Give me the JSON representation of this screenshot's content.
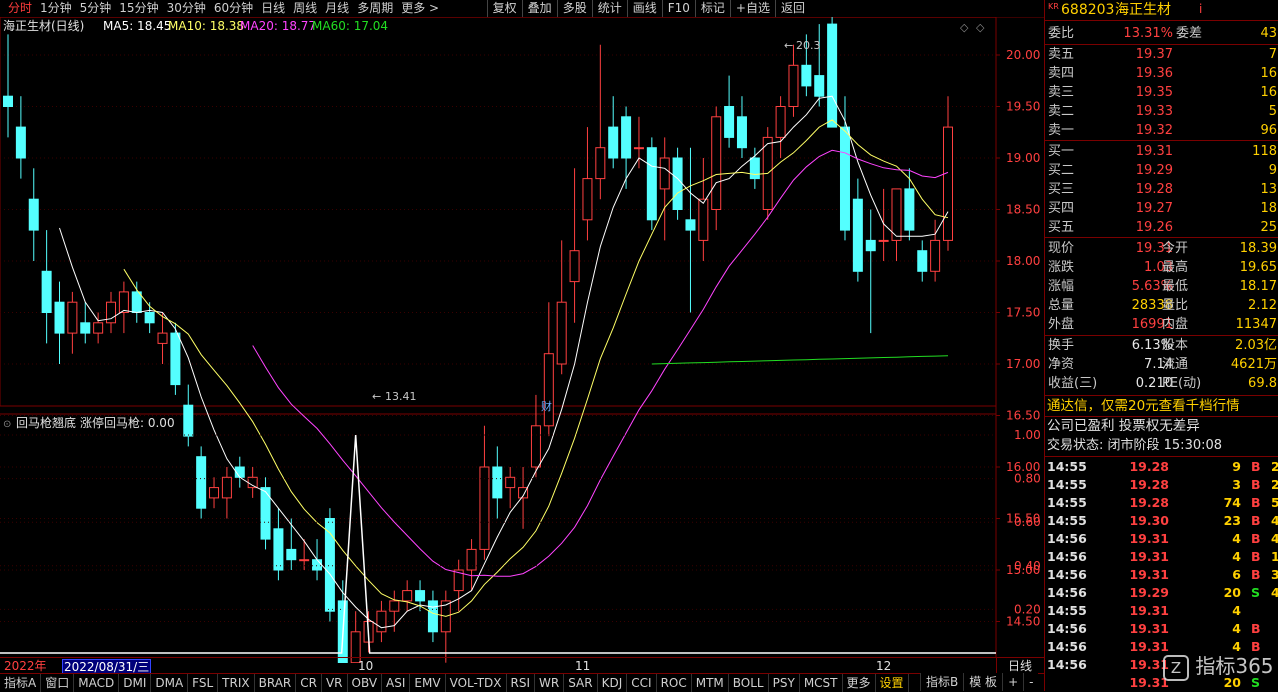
{
  "toolbar": {
    "periods": [
      "分时",
      "1分钟",
      "5分钟",
      "15分钟",
      "30分钟",
      "60分钟",
      "日线",
      "周线",
      "月线",
      "多周期",
      "更多 >"
    ],
    "active_period": "分时",
    "tools": [
      "复权",
      "叠加",
      "多股",
      "统计",
      "画线",
      "F10",
      "标记",
      "+自选",
      "返回"
    ]
  },
  "chart_header": {
    "stock": "海正生材(日线)",
    "ma5": "MA5: 18.45",
    "ma10": "MA10: 18.38",
    "ma20": "MA20: 18.77",
    "ma60": "MA60: 17.04",
    "high_label": "20.3",
    "low_label": "13.41",
    "marker": "财"
  },
  "indicator_header": {
    "name": "回马枪翘底",
    "value": "涨停回马枪: 0.00"
  },
  "chart_data": [
    {
      "type": "candlestick",
      "title": "海正生材(日线)",
      "y_ticks": [
        "20.00",
        "19.50",
        "19.00",
        "18.50",
        "18.00",
        "17.50",
        "17.00",
        "16.50",
        "16.00",
        "15.50",
        "15.00",
        "14.50",
        "14.00"
      ],
      "series": [
        {
          "name": "MA5",
          "color": "#ffffff"
        },
        {
          "name": "MA10",
          "color": "#ffff66"
        },
        {
          "name": "MA20",
          "color": "#ff44ff"
        },
        {
          "name": "MA60",
          "color": "#22dd22"
        }
      ],
      "ohlc": [
        [
          19.6,
          20.2,
          19.2,
          19.5
        ],
        [
          19.3,
          19.6,
          18.8,
          19.0
        ],
        [
          18.6,
          18.9,
          18.0,
          18.3
        ],
        [
          17.9,
          18.3,
          17.2,
          17.5
        ],
        [
          17.6,
          17.8,
          17.0,
          17.3
        ],
        [
          17.3,
          17.7,
          17.1,
          17.6
        ],
        [
          17.4,
          17.6,
          17.2,
          17.3
        ],
        [
          17.3,
          17.5,
          17.2,
          17.4
        ],
        [
          17.4,
          17.7,
          17.3,
          17.6
        ],
        [
          17.5,
          17.8,
          17.3,
          17.7
        ],
        [
          17.7,
          17.8,
          17.4,
          17.5
        ],
        [
          17.5,
          17.6,
          17.3,
          17.4
        ],
        [
          17.2,
          17.5,
          17.0,
          17.3
        ],
        [
          17.3,
          17.4,
          16.7,
          16.8
        ],
        [
          16.6,
          16.8,
          16.2,
          16.3
        ],
        [
          16.1,
          16.2,
          15.5,
          15.6
        ],
        [
          15.7,
          15.9,
          15.6,
          15.8
        ],
        [
          15.7,
          16.0,
          15.5,
          15.9
        ],
        [
          16.0,
          16.1,
          15.8,
          15.9
        ],
        [
          15.8,
          16.0,
          15.7,
          15.9
        ],
        [
          15.8,
          15.9,
          15.2,
          15.3
        ],
        [
          15.4,
          15.6,
          14.9,
          15.0
        ],
        [
          15.2,
          15.5,
          15.0,
          15.1
        ],
        [
          15.1,
          15.3,
          15.0,
          15.1
        ],
        [
          15.1,
          15.3,
          14.9,
          15.0
        ],
        [
          15.5,
          15.6,
          14.5,
          14.6
        ],
        [
          14.7,
          14.9,
          13.9,
          14.1
        ],
        [
          14.1,
          14.6,
          13.6,
          14.4
        ],
        [
          14.3,
          14.6,
          14.2,
          14.5
        ],
        [
          14.4,
          14.7,
          14.3,
          14.6
        ],
        [
          14.6,
          14.8,
          14.4,
          14.7
        ],
        [
          14.7,
          14.9,
          14.6,
          14.8
        ],
        [
          14.8,
          14.9,
          14.6,
          14.7
        ],
        [
          14.7,
          14.8,
          14.3,
          14.4
        ],
        [
          14.4,
          14.8,
          14.1,
          14.7
        ],
        [
          14.8,
          15.1,
          14.6,
          15.0
        ],
        [
          15.0,
          15.3,
          14.8,
          15.2
        ],
        [
          15.2,
          16.4,
          15.1,
          16.0
        ],
        [
          16.0,
          16.2,
          15.5,
          15.7
        ],
        [
          15.8,
          16.0,
          15.6,
          15.9
        ],
        [
          15.7,
          16.0,
          15.4,
          15.8
        ],
        [
          16.0,
          16.7,
          15.9,
          16.4
        ],
        [
          16.4,
          17.6,
          16.3,
          17.1
        ],
        [
          17.0,
          18.2,
          16.9,
          17.6
        ],
        [
          17.8,
          18.9,
          17.4,
          18.1
        ],
        [
          18.4,
          19.3,
          18.2,
          18.8
        ],
        [
          18.8,
          20.1,
          18.6,
          19.1
        ],
        [
          19.3,
          19.6,
          18.9,
          19.0
        ],
        [
          19.4,
          19.5,
          18.7,
          19.0
        ],
        [
          19.1,
          19.4,
          18.9,
          19.1
        ],
        [
          19.1,
          19.2,
          18.3,
          18.4
        ],
        [
          18.7,
          19.2,
          18.2,
          19.0
        ],
        [
          19.0,
          19.1,
          18.4,
          18.5
        ],
        [
          18.4,
          19.1,
          17.5,
          18.3
        ],
        [
          18.2,
          19.0,
          18.0,
          18.6
        ],
        [
          18.5,
          19.5,
          18.3,
          19.4
        ],
        [
          19.5,
          19.8,
          19.1,
          19.2
        ],
        [
          19.4,
          19.6,
          19.0,
          19.1
        ],
        [
          19.0,
          19.1,
          18.7,
          18.8
        ],
        [
          18.5,
          19.3,
          18.4,
          19.2
        ],
        [
          19.2,
          19.6,
          19.0,
          19.5
        ],
        [
          19.5,
          20.1,
          19.4,
          19.9
        ],
        [
          19.9,
          20.2,
          19.6,
          19.7
        ],
        [
          19.8,
          20.3,
          19.5,
          19.6
        ],
        [
          20.3,
          20.4,
          19.3,
          19.3
        ],
        [
          19.3,
          19.6,
          18.2,
          18.3
        ],
        [
          18.6,
          18.8,
          17.8,
          17.9
        ],
        [
          18.2,
          18.5,
          17.3,
          18.1
        ],
        [
          18.2,
          18.7,
          18.0,
          18.2
        ],
        [
          18.2,
          18.7,
          18.0,
          18.7
        ],
        [
          18.7,
          18.9,
          18.2,
          18.3
        ],
        [
          18.1,
          18.2,
          17.8,
          17.9
        ],
        [
          17.9,
          18.4,
          17.8,
          18.2
        ],
        [
          18.2,
          19.6,
          18.1,
          19.3
        ]
      ]
    },
    {
      "type": "line",
      "title": "回马枪翘底",
      "y_ticks": [
        "1.00",
        "0.80",
        "0.60",
        "0.40",
        "0.20"
      ],
      "x_labels": [
        "2022年",
        "2022/08/31/三",
        "10",
        "11",
        "12"
      ],
      "spike": {
        "name": "涨停回马枪",
        "peak_value": 1.0
      }
    }
  ],
  "panel": {
    "code": "688203",
    "name": "海正生材",
    "weibi": {
      "label": "委比",
      "value": "13.31%",
      "label2": "委差",
      "value2": "43"
    },
    "asks": [
      {
        "label": "卖五",
        "price": "19.37",
        "vol": "7"
      },
      {
        "label": "卖四",
        "price": "19.36",
        "vol": "16"
      },
      {
        "label": "卖三",
        "price": "19.35",
        "vol": "16"
      },
      {
        "label": "卖二",
        "price": "19.33",
        "vol": "5"
      },
      {
        "label": "卖一",
        "price": "19.32",
        "vol": "96"
      }
    ],
    "bids": [
      {
        "label": "买一",
        "price": "19.31",
        "vol": "118"
      },
      {
        "label": "买二",
        "price": "19.29",
        "vol": "9"
      },
      {
        "label": "买三",
        "price": "19.28",
        "vol": "13"
      },
      {
        "label": "买四",
        "price": "19.27",
        "vol": "18"
      },
      {
        "label": "买五",
        "price": "19.26",
        "vol": "25"
      }
    ],
    "stats": [
      {
        "l1": "现价",
        "v1": "19.31",
        "l2": "今开",
        "v2": "18.39"
      },
      {
        "l1": "涨跌",
        "v1": "1.03",
        "l2": "最高",
        "v2": "19.65"
      },
      {
        "l1": "涨幅",
        "v1": "5.63%",
        "l2": "最低",
        "v2": "18.17"
      },
      {
        "l1": "总量",
        "v1": "28338",
        "l2": "量比",
        "v2": "2.12"
      },
      {
        "l1": "外盘",
        "v1": "16991",
        "l2": "内盘",
        "v2": "11347"
      }
    ],
    "stats2": [
      {
        "l1": "换手",
        "v1": "6.13%",
        "l2": "股本",
        "v2": "2.03亿"
      },
      {
        "l1": "净资",
        "v1": "7.14",
        "l2": "流通",
        "v2": "4621万"
      },
      {
        "l1": "收益(三)",
        "v1": "0.210",
        "l2": "PE(动)",
        "v2": "69.8"
      }
    ],
    "ad": "通达信，仅需20元查看千档行情",
    "info": "公司已盈利 投票权无差异",
    "trade_status": "交易状态: 闭市阶段 15:30:08",
    "ticks": [
      {
        "t": "14:55",
        "p": "19.28",
        "v": "9",
        "d": "B",
        "n": "2"
      },
      {
        "t": "14:55",
        "p": "19.28",
        "v": "3",
        "d": "B",
        "n": "2"
      },
      {
        "t": "14:55",
        "p": "19.28",
        "v": "74",
        "d": "B",
        "n": "5"
      },
      {
        "t": "14:55",
        "p": "19.30",
        "v": "23",
        "d": "B",
        "n": "4"
      },
      {
        "t": "14:56",
        "p": "19.31",
        "v": "4",
        "d": "B",
        "n": "4"
      },
      {
        "t": "14:56",
        "p": "19.31",
        "v": "4",
        "d": "B",
        "n": "1"
      },
      {
        "t": "14:56",
        "p": "19.31",
        "v": "6",
        "d": "B",
        "n": "3"
      },
      {
        "t": "14:56",
        "p": "19.29",
        "v": "20",
        "d": "S",
        "n": "4"
      },
      {
        "t": "14:55",
        "p": "19.31",
        "v": "4",
        "d": "",
        "n": ""
      },
      {
        "t": "14:56",
        "p": "19.31",
        "v": "4",
        "d": "B",
        "n": ""
      },
      {
        "t": "14:56",
        "p": "19.31",
        "v": "4",
        "d": "B",
        "n": ""
      },
      {
        "t": "14:56",
        "p": "19.31",
        "v": "",
        "d": "",
        "n": ""
      },
      {
        "t": "",
        "p": "19.31",
        "v": "20",
        "d": "S",
        "n": ""
      }
    ]
  },
  "bottom": {
    "year": "2022年",
    "date": "2022/08/31/三",
    "month_labels": [
      "10",
      "11",
      "12"
    ],
    "period_btn": "日线",
    "tabs": [
      "指标A",
      "窗口",
      "MACD",
      "DMI",
      "DMA",
      "FSL",
      "TRIX",
      "BRAR",
      "CR",
      "VR",
      "OBV",
      "ASI",
      "EMV",
      "VOL-TDX",
      "RSI",
      "WR",
      "SAR",
      "KDJ",
      "CCI",
      "ROC",
      "MTM",
      "BOLL",
      "PSY",
      "MCST",
      "更多",
      "设置"
    ],
    "right_tabs": [
      "指标B",
      "模 板",
      "+",
      "-"
    ],
    "watermark": "指标365"
  },
  "colors": {
    "up": "#ff4040",
    "down": "#54ffff",
    "ma5": "#ffffff",
    "ma10": "#ffff66",
    "ma20": "#ff44ff",
    "ma60": "#22dd22",
    "border": "#7a0000"
  }
}
